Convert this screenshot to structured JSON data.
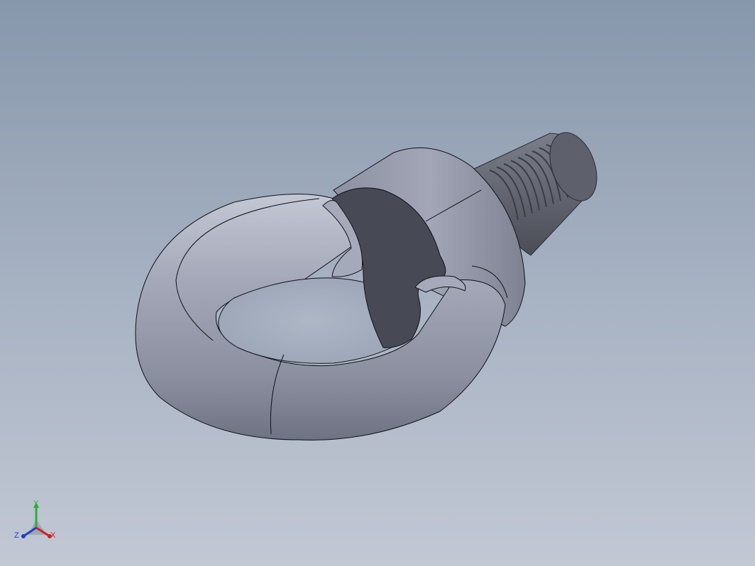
{
  "viewport": {
    "background_top": "#8797ab",
    "background_bottom": "#c2c8d4",
    "model_color": "#9ea2b2",
    "edge_color": "#101018",
    "model_name": "eye-bolt"
  },
  "triad": {
    "x_label": "X",
    "y_label": "Y",
    "z_label": "Z",
    "x_color": "#d02020",
    "y_color": "#2fae3a",
    "z_color": "#2040c0"
  }
}
